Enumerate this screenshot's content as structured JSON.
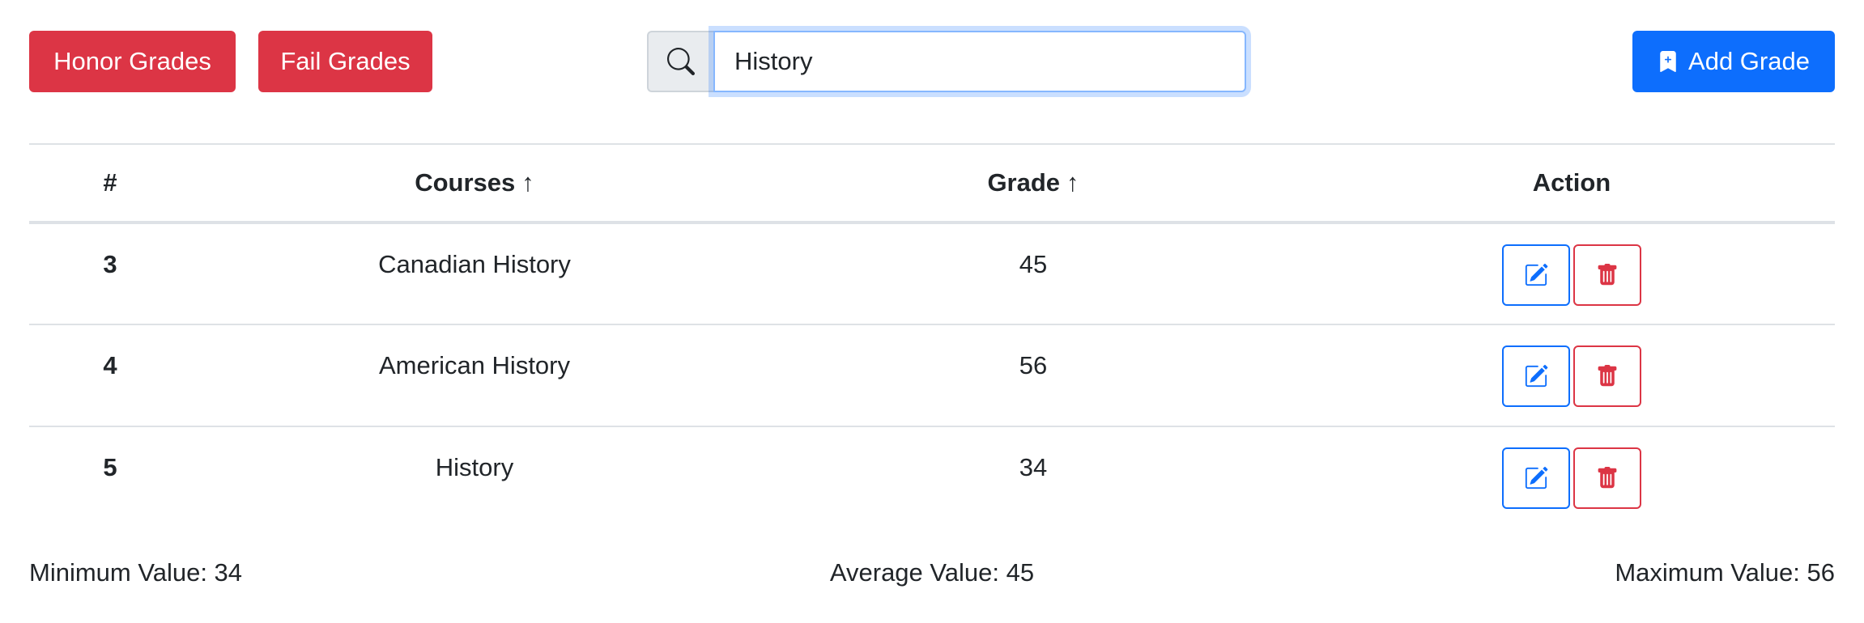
{
  "toolbar": {
    "honor_label": "Honor Grades",
    "fail_label": "Fail Grades",
    "add_label": "Add Grade",
    "colors": {
      "danger": "#dc3545",
      "primary": "#0d6efd"
    }
  },
  "search": {
    "value": "History",
    "icon": "search-icon"
  },
  "table": {
    "headers": {
      "num": "#",
      "courses": "Courses",
      "grade": "Grade",
      "action": "Action",
      "sort_arrow": "↑"
    },
    "rows": [
      {
        "num": "3",
        "course": "Canadian History",
        "grade": "45"
      },
      {
        "num": "4",
        "course": "American History",
        "grade": "56"
      },
      {
        "num": "5",
        "course": "History",
        "grade": "34"
      }
    ],
    "row_action_icons": [
      "edit-icon",
      "trash-icon"
    ]
  },
  "stats": {
    "min": "Minimum Value: 34",
    "avg": "Average Value: 45",
    "max": "Maximum Value: 56"
  }
}
